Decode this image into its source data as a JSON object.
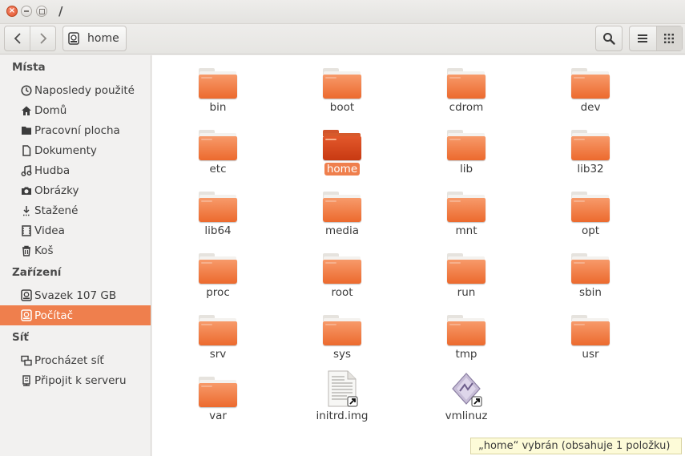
{
  "window": {
    "title": "/"
  },
  "toolbar": {
    "path_label": "home"
  },
  "sidebar": {
    "sections": {
      "places": "Místa",
      "devices": "Zařízení",
      "network": "Síť"
    },
    "items": [
      {
        "label": "Naposledy použité",
        "icon": "clock-icon"
      },
      {
        "label": "Domů",
        "icon": "home-icon"
      },
      {
        "label": "Pracovní plocha",
        "icon": "desktop-folder-icon"
      },
      {
        "label": "Dokumenty",
        "icon": "document-icon"
      },
      {
        "label": "Hudba",
        "icon": "music-icon"
      },
      {
        "label": "Obrázky",
        "icon": "camera-icon"
      },
      {
        "label": "Stažené",
        "icon": "download-icon"
      },
      {
        "label": "Videa",
        "icon": "film-icon"
      },
      {
        "label": "Koš",
        "icon": "trash-icon"
      },
      {
        "label": "Svazek 107 GB",
        "icon": "drive-icon"
      },
      {
        "label": "Počítač",
        "icon": "drive-icon",
        "selected": true
      },
      {
        "label": "Procházet síť",
        "icon": "network-icon"
      },
      {
        "label": "Připojit k serveru",
        "icon": "server-icon"
      }
    ]
  },
  "files": [
    {
      "name": "bin",
      "type": "folder"
    },
    {
      "name": "boot",
      "type": "folder"
    },
    {
      "name": "cdrom",
      "type": "folder"
    },
    {
      "name": "dev",
      "type": "folder"
    },
    {
      "name": "etc",
      "type": "folder"
    },
    {
      "name": "home",
      "type": "folder",
      "selected": true
    },
    {
      "name": "lib",
      "type": "folder"
    },
    {
      "name": "lib32",
      "type": "folder"
    },
    {
      "name": "lib64",
      "type": "folder"
    },
    {
      "name": "media",
      "type": "folder"
    },
    {
      "name": "mnt",
      "type": "folder"
    },
    {
      "name": "opt",
      "type": "folder"
    },
    {
      "name": "proc",
      "type": "folder"
    },
    {
      "name": "root",
      "type": "folder"
    },
    {
      "name": "run",
      "type": "folder"
    },
    {
      "name": "sbin",
      "type": "folder"
    },
    {
      "name": "srv",
      "type": "folder"
    },
    {
      "name": "sys",
      "type": "folder"
    },
    {
      "name": "tmp",
      "type": "folder"
    },
    {
      "name": "usr",
      "type": "folder"
    },
    {
      "name": "var",
      "type": "folder"
    },
    {
      "name": "initrd.img",
      "type": "document-symlink"
    },
    {
      "name": "vmlinuz",
      "type": "binary-symlink"
    }
  ],
  "status": {
    "text": "„home“ vybrán  (obsahuje 1 položku)"
  },
  "colors": {
    "accent": "#ef7f4d",
    "folder": "#ec6a2e"
  }
}
